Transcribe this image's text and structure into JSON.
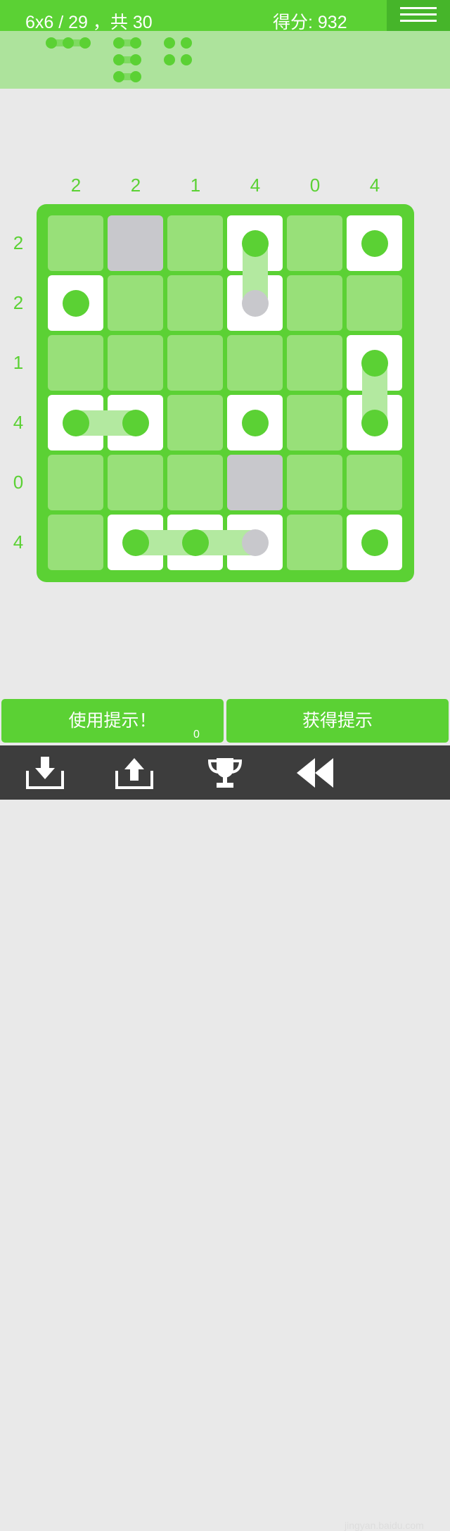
{
  "header": {
    "level_text": "6x6 / 29 ，共 30",
    "score_text": "得分: 932"
  },
  "icons": {
    "menu": "hamburger-menu-icon",
    "import": "download-tray-icon",
    "export": "upload-tray-icon",
    "leaderboard": "trophy-icon",
    "undo": "rewind-icon"
  },
  "colors": {
    "primary_green": "#5bd134",
    "dark_green": "#46b52a",
    "empty_cell": "#98e079",
    "link": "#b3e9a0",
    "blocked_cell": "#c8c8cc",
    "tray": "#ade39c",
    "toolbar": "#3d3d3d",
    "background": "#e9e9e9"
  },
  "column_clues": [
    "2",
    "2",
    "1",
    "4",
    "0",
    "4"
  ],
  "row_clues": [
    "2",
    "2",
    "1",
    "4",
    "0",
    "4"
  ],
  "board": [
    [
      "empty",
      "gray",
      "empty",
      "white",
      "empty",
      "white"
    ],
    [
      "white",
      "empty",
      "empty",
      "white",
      "empty",
      "empty"
    ],
    [
      "empty",
      "empty",
      "empty",
      "empty",
      "empty",
      "white"
    ],
    [
      "white",
      "white",
      "empty",
      "white",
      "empty",
      "white"
    ],
    [
      "empty",
      "empty",
      "empty",
      "gray",
      "empty",
      "empty"
    ],
    [
      "empty",
      "white",
      "white",
      "white",
      "empty",
      "white"
    ]
  ],
  "remaining_pieces": [
    "horizontal-3",
    "vertical-3-pair",
    "square-2x2"
  ],
  "buttons": {
    "use_hint_label": "使用提示！",
    "hint_count": "0",
    "get_hint_label": "获得提示"
  },
  "watermark_text": "jingyan.baidu.com"
}
